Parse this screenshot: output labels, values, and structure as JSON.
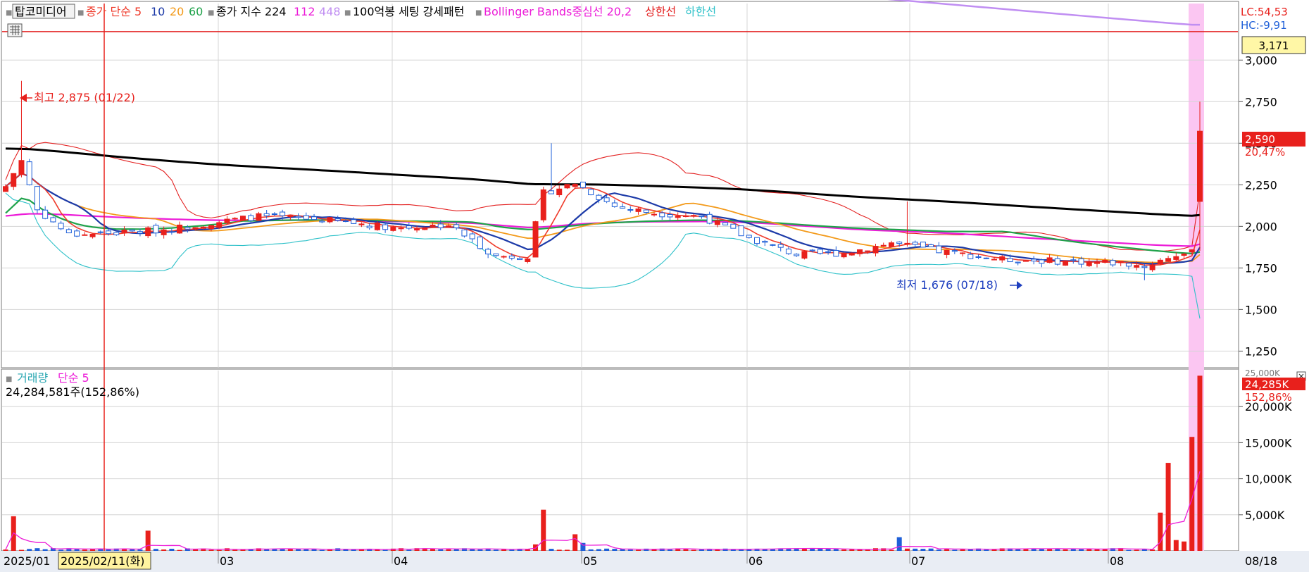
{
  "colors": {
    "up": "#e8201c",
    "down": "#1e5fd8",
    "ma5": "#ef3a2a",
    "ma10": "#1c3aa8",
    "ma20": "#f39a1a",
    "ma60": "#1fa24a",
    "idx224": "#000000",
    "idx112": "#ec1cd8",
    "idx448": "#c08ef2",
    "bb_upper": "#e32020",
    "bb_lower": "#2ec1c9",
    "price_box": "#e8201c",
    "highlight": "#fbc6f2",
    "cursor_line": "#e8201c",
    "grid": "#d4d4d4",
    "legend_vol": "#2aa7b2"
  },
  "price_panel": {
    "legend": [
      {
        "text": "탑코미디어",
        "color": "#000000",
        "box": true
      },
      {
        "text": "종가 단순 5",
        "color": "#ef3a2a",
        "marker": true
      },
      {
        "text": "10",
        "color": "#1c3aa8"
      },
      {
        "text": "20",
        "color": "#f39a1a"
      },
      {
        "text": "60",
        "color": "#1fa24a"
      },
      {
        "text": "종가 지수 224",
        "color": "#000000",
        "marker": true
      },
      {
        "text": "112",
        "color": "#ec1cd8"
      },
      {
        "text": "448",
        "color": "#c08ef2"
      },
      {
        "text": "100억봉 세팅 강세패턴",
        "color": "#000000",
        "marker": true
      },
      {
        "text": "Bollinger Bands중심선 20,2",
        "color": "#ec1cd8",
        "marker": true
      },
      {
        "text": "상한선",
        "color": "#e32020"
      },
      {
        "text": "하한선",
        "color": "#2ec1c9"
      }
    ],
    "lc": "LC:54,53",
    "hc": "HC:-9,91",
    "hline_label": "3,171",
    "current_price": "2,590",
    "current_change": "20,47%",
    "high_label": "최고 2,875 (01/22)",
    "low_label": "최저 1,676 (07/18)"
  },
  "volume_panel": {
    "legend_title": "거래량",
    "legend_ma": "단순 5",
    "info": "24,284,581주(152,86%)",
    "current_volume": "24,285K",
    "current_ratio": "152,86%",
    "top_tick": "25,000K"
  },
  "x_axis": {
    "labels": [
      "2025/01",
      "2025/02/11(화)",
      "03",
      "04",
      "05",
      "06",
      "07",
      "08",
      "08/18"
    ]
  },
  "chart_data": {
    "type": "candlestick",
    "title": "탑코미디어",
    "price_axis": {
      "ticks": [
        "3,000",
        "2,750",
        "2,500",
        "2,250",
        "2,000",
        "1,750",
        "1,500",
        "1,250"
      ],
      "ylim": [
        1150,
        3340
      ]
    },
    "volume_axis": {
      "ticks": [
        "20,000K",
        "15,000K",
        "10,000K",
        "5,000K"
      ],
      "ylim": [
        0,
        25000
      ]
    },
    "horizontal_line": 3171,
    "marked_high": {
      "date": "01/22",
      "value": 2875
    },
    "marked_low": {
      "date": "07/18",
      "value": 1676
    },
    "last_close": 2590,
    "last_change_pct": 20.47,
    "last_volume": 24284581,
    "last_volume_ratio_pct": 152.86
  }
}
